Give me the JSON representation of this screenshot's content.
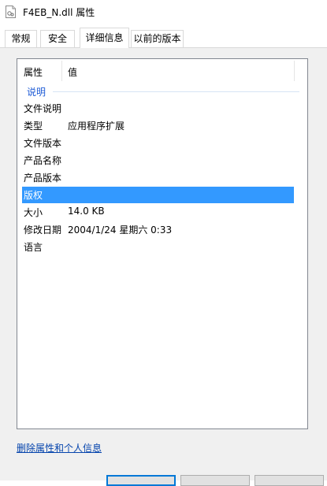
{
  "window": {
    "title": "F4EB_N.dll 属性"
  },
  "tabs": [
    {
      "label": "常规"
    },
    {
      "label": "安全"
    },
    {
      "label": "详细信息",
      "active": true
    },
    {
      "label": "以前的版本"
    }
  ],
  "details": {
    "columns": {
      "name": "属性",
      "value": "值"
    },
    "group": "说明",
    "rows": [
      {
        "name": "文件说明",
        "value": ""
      },
      {
        "name": "类型",
        "value": "应用程序扩展"
      },
      {
        "name": "文件版本",
        "value": ""
      },
      {
        "name": "产品名称",
        "value": ""
      },
      {
        "name": "产品版本",
        "value": ""
      },
      {
        "name": "版权",
        "value": "",
        "selected": true
      },
      {
        "name": "大小",
        "value": "14.0 KB"
      },
      {
        "name": "修改日期",
        "value": "2004/1/24 星期六 0:33"
      },
      {
        "name": "语言",
        "value": ""
      }
    ]
  },
  "remove_link": "删除属性和个人信息",
  "colors": {
    "selection": "#3399ff",
    "link": "#0645ad",
    "group": "#1e5bd6"
  }
}
